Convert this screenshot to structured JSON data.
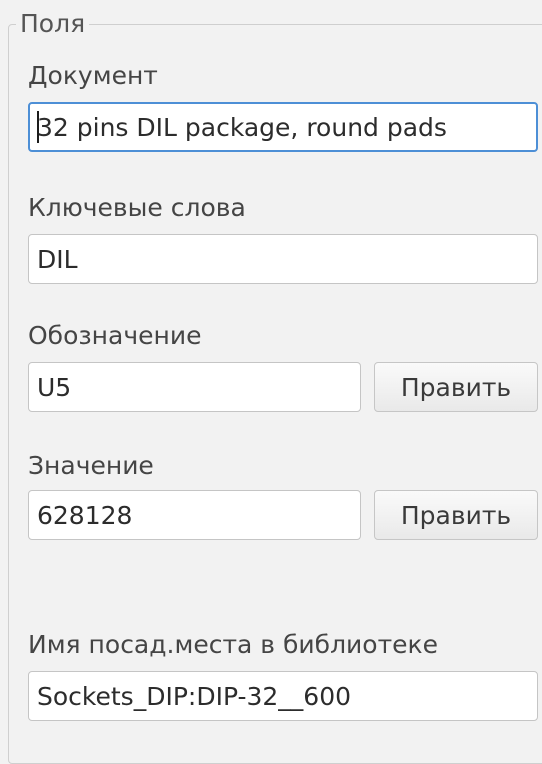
{
  "group": {
    "title": "Поля"
  },
  "document": {
    "label": "Документ",
    "value": "32 pins DIL package, round pads"
  },
  "keywords": {
    "label": "Ключевые слова",
    "value": "DIL"
  },
  "reference": {
    "label": "Обозначение",
    "value": "U5",
    "edit_label": "Править"
  },
  "value_field": {
    "label": "Значение",
    "value": "628128",
    "edit_label": "Править"
  },
  "footprint": {
    "label": "Имя посад.места в библиотеке",
    "value": "Sockets_DIP:DIP-32__600"
  }
}
